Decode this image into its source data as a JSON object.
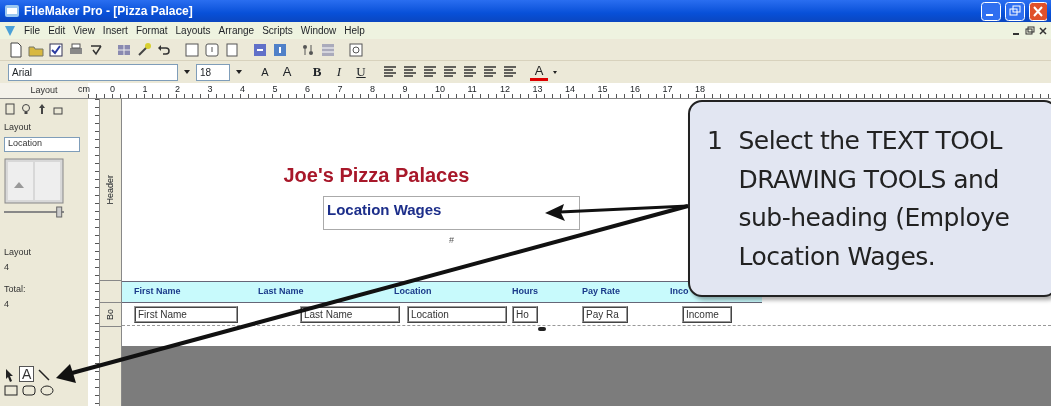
{
  "window": {
    "title": "FileMaker Pro - [Pizza Palace]"
  },
  "menu": [
    "File",
    "Edit",
    "View",
    "Insert",
    "Format",
    "Layouts",
    "Arrange",
    "Scripts",
    "Window",
    "Help"
  ],
  "format_bar": {
    "font": "Arial",
    "size": "18",
    "grow_buttons": [
      "A",
      "A"
    ],
    "style_buttons": [
      "B",
      "I",
      "U"
    ],
    "color_button": "A"
  },
  "ruler": {
    "unit": "cm",
    "marks": [
      "0",
      "1",
      "2",
      "3",
      "4",
      "5",
      "6",
      "7",
      "8",
      "9",
      "10",
      "11",
      "12",
      "13",
      "14",
      "15",
      "16",
      "17",
      "18"
    ]
  },
  "sidebar": {
    "tab": "Layout",
    "layout_label": "Layout",
    "layout_select": "Location",
    "count_label": "Layout",
    "count": "4",
    "total_label": "Total:",
    "total": "4",
    "text_tool": "A",
    "zoom_slider": {
      "level": 0.92
    }
  },
  "parts": [
    {
      "label": "Header"
    },
    {
      "label": "Bo"
    }
  ],
  "layout": {
    "title": "Joe's Pizza Palaces",
    "subtitle": "Location Wages",
    "page_number": "#",
    "columns": [
      "First Name",
      "Last Name",
      "Location",
      "Hours",
      "Pay Rate",
      "Inco"
    ],
    "fields": [
      "First Name",
      "Last Name",
      "Location",
      "Ho",
      "Pay Ra",
      "Income"
    ]
  },
  "callout": {
    "number": "1",
    "lines": [
      "Select the TEXT TOOL",
      "DRAWING TOOLS and",
      "sub-heading (Employe",
      "Location Wages."
    ]
  }
}
